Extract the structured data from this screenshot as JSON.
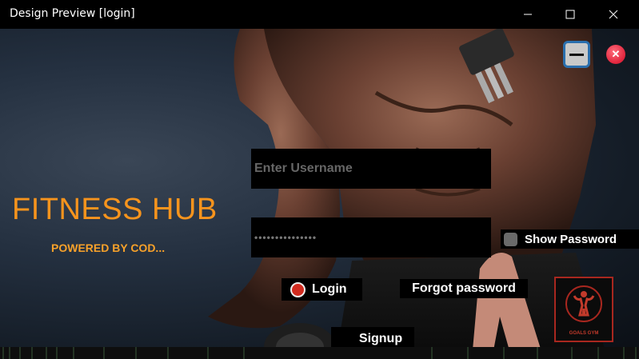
{
  "window": {
    "title": "Design Preview [login]",
    "minimize_icon": "minimize-icon",
    "maximize_icon": "maximize-icon",
    "close_icon": "close-icon"
  },
  "brand": {
    "title": "FITNESS HUB",
    "subtitle": "POWERED BY COD...",
    "title_color": "#f7941d"
  },
  "form": {
    "username_placeholder": "Enter Username",
    "password_value": "•••••••••••••••",
    "show_password_label": "Show Password",
    "show_password_checked": false,
    "login_label": "Login",
    "forgot_label": "Forgot password",
    "signup_label": "Signup"
  },
  "logo": {
    "text": "GOALS GYM",
    "accent": "#c23a2b"
  },
  "colors": {
    "accent": "#f7941d",
    "login_radio": "#d12b1f",
    "app_close": "#e0243c",
    "app_min_border": "#2a6fae"
  }
}
